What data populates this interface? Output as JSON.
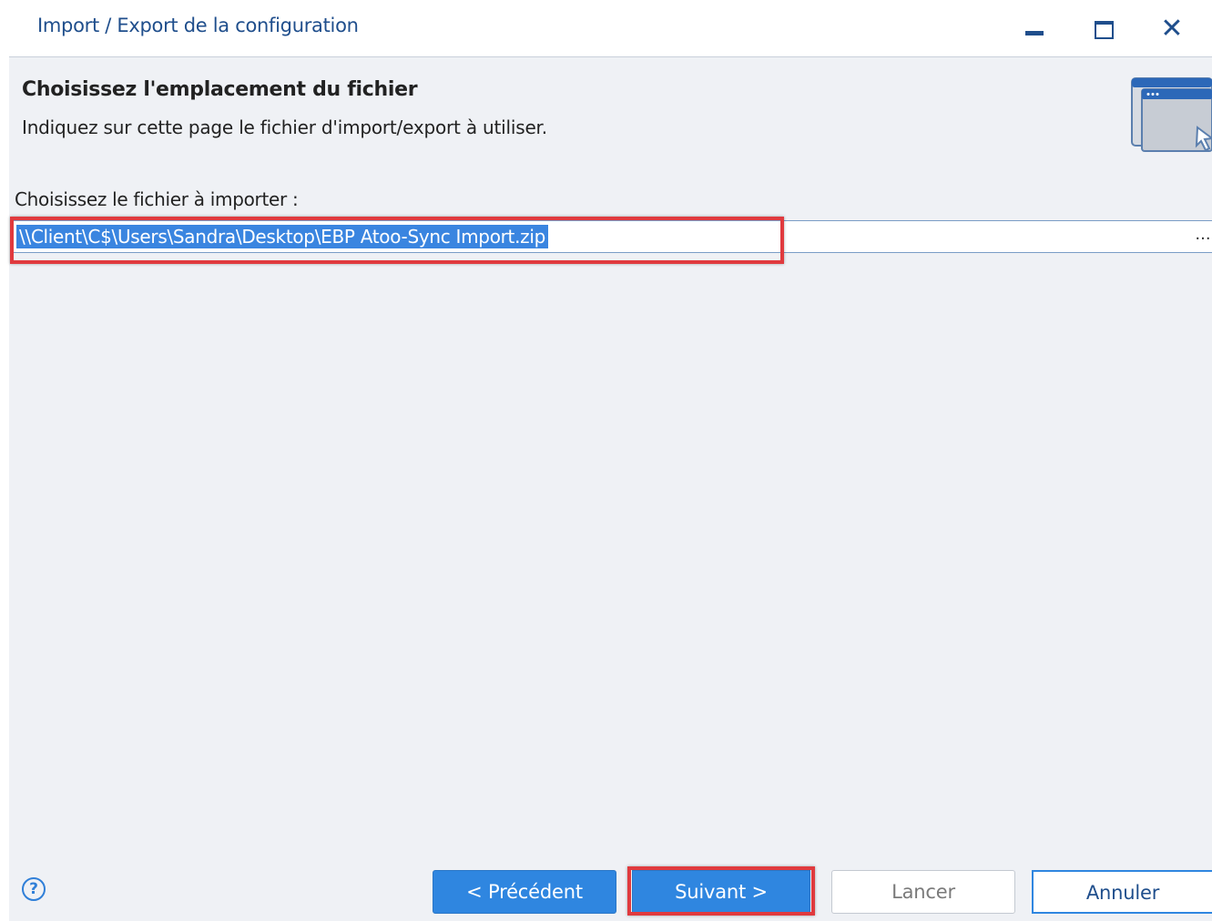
{
  "window": {
    "title": "Import / Export de la configuration"
  },
  "header": {
    "title": "Choisissez l'emplacement du fichier",
    "description": "Indiquez sur cette page le fichier d'import/export à utiliser."
  },
  "file_field": {
    "label": "Choisissez le fichier à importer :",
    "value": "\\\\Client\\C$\\Users\\Sandra\\Desktop\\EBP Atoo-Sync Import.zip",
    "browse_label": "..."
  },
  "footer": {
    "help_label": "?",
    "prev_label": "< Précédent",
    "next_label": "Suivant >",
    "launch_label": "Lancer",
    "cancel_label": "Annuler"
  },
  "colors": {
    "accent": "#2f86e0",
    "title_text": "#1f4e8c",
    "annotation": "#e03a3e",
    "body_background": "#eff1f5"
  },
  "icons": {
    "minimize": "minimize-icon",
    "maximize": "maximize-icon",
    "close": "close-icon",
    "wizard": "window-cursor-icon",
    "help": "help-icon"
  }
}
